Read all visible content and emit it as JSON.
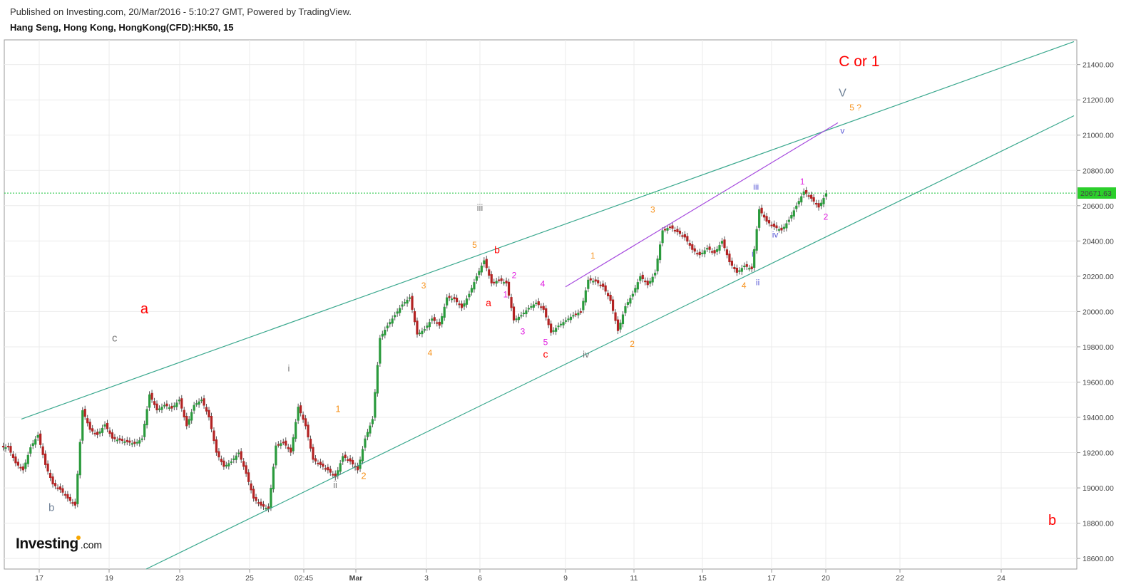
{
  "header": {
    "published": "Published on Investing.com, 20/Mar/2016 - 5:10:27 GMT, Powered by TradingView.",
    "symbol": "Hang Seng, Hong Kong, HongKong(CFD):HK50, 15"
  },
  "logo": {
    "brand": "Investing",
    "suffix": ".com"
  },
  "colors": {
    "up_candle": "#2a9a3c",
    "down_candle": "#b22222",
    "channel": "#3aa88e",
    "wedge_line": "#a64bde",
    "price_line": "#19c43a",
    "price_label_bg": "#2bcf2b",
    "grid": "#ebebeb"
  },
  "chart_data": {
    "type": "candlestick",
    "title": "",
    "xlabel": "",
    "ylabel": "",
    "ylim": [
      18540,
      21540
    ],
    "y_ticks": [
      "21400.00",
      "21200.00",
      "21000.00",
      "20800.00",
      "20600.00",
      "20400.00",
      "20200.00",
      "20000.00",
      "19800.00",
      "19600.00",
      "19400.00",
      "19200.00",
      "19000.00",
      "18800.00",
      "18600.00"
    ],
    "x_ticks": [
      "17",
      "19",
      "23",
      "25",
      "02:45",
      "Mar",
      "3",
      "6",
      "9",
      "11",
      "15",
      "17",
      "20",
      "22",
      "24"
    ],
    "current_price": "20671.63",
    "price_path": [
      [
        0,
        19230
      ],
      [
        1,
        19140
      ],
      [
        2,
        19100
      ],
      [
        3,
        19230
      ],
      [
        4,
        19300
      ],
      [
        5,
        19130
      ],
      [
        6,
        19020
      ],
      [
        7,
        18990
      ],
      [
        8,
        18940
      ],
      [
        9,
        18900
      ],
      [
        10,
        19440
      ],
      [
        11,
        19330
      ],
      [
        12,
        19300
      ],
      [
        13,
        19360
      ],
      [
        14,
        19280
      ],
      [
        15,
        19270
      ],
      [
        16,
        19260
      ],
      [
        17,
        19250
      ],
      [
        18,
        19280
      ],
      [
        19,
        19530
      ],
      [
        20,
        19440
      ],
      [
        21,
        19470
      ],
      [
        22,
        19450
      ],
      [
        23,
        19500
      ],
      [
        24,
        19350
      ],
      [
        25,
        19470
      ],
      [
        26,
        19500
      ],
      [
        27,
        19400
      ],
      [
        28,
        19200
      ],
      [
        29,
        19120
      ],
      [
        30,
        19150
      ],
      [
        31,
        19200
      ],
      [
        32,
        19080
      ],
      [
        33,
        18940
      ],
      [
        34,
        18900
      ],
      [
        35,
        18880
      ],
      [
        36,
        19240
      ],
      [
        37,
        19260
      ],
      [
        38,
        19200
      ],
      [
        39,
        19460
      ],
      [
        40,
        19350
      ],
      [
        41,
        19160
      ],
      [
        42,
        19130
      ],
      [
        43,
        19100
      ],
      [
        44,
        19060
      ],
      [
        45,
        19180
      ],
      [
        46,
        19150
      ],
      [
        47,
        19100
      ],
      [
        48,
        19280
      ],
      [
        49,
        19390
      ],
      [
        50,
        19850
      ],
      [
        51,
        19920
      ],
      [
        52,
        19980
      ],
      [
        53,
        20040
      ],
      [
        54,
        20080
      ],
      [
        55,
        19870
      ],
      [
        56,
        19900
      ],
      [
        57,
        19960
      ],
      [
        58,
        19920
      ],
      [
        59,
        20080
      ],
      [
        60,
        20070
      ],
      [
        61,
        20020
      ],
      [
        62,
        20100
      ],
      [
        63,
        20200
      ],
      [
        64,
        20290
      ],
      [
        65,
        20160
      ],
      [
        66,
        20180
      ],
      [
        67,
        20160
      ],
      [
        68,
        19950
      ],
      [
        69,
        19980
      ],
      [
        70,
        20020
      ],
      [
        71,
        20050
      ],
      [
        72,
        20010
      ],
      [
        73,
        19880
      ],
      [
        74,
        19920
      ],
      [
        75,
        19950
      ],
      [
        76,
        19980
      ],
      [
        77,
        20000
      ],
      [
        78,
        20180
      ],
      [
        79,
        20170
      ],
      [
        80,
        20140
      ],
      [
        81,
        20060
      ],
      [
        82,
        19890
      ],
      [
        83,
        20030
      ],
      [
        84,
        20100
      ],
      [
        85,
        20200
      ],
      [
        86,
        20150
      ],
      [
        87,
        20220
      ],
      [
        88,
        20460
      ],
      [
        89,
        20480
      ],
      [
        90,
        20450
      ],
      [
        91,
        20420
      ],
      [
        92,
        20350
      ],
      [
        93,
        20320
      ],
      [
        94,
        20360
      ],
      [
        95,
        20330
      ],
      [
        96,
        20400
      ],
      [
        97,
        20280
      ],
      [
        98,
        20220
      ],
      [
        99,
        20260
      ],
      [
        100,
        20240
      ],
      [
        101,
        20580
      ],
      [
        102,
        20510
      ],
      [
        103,
        20480
      ],
      [
        104,
        20460
      ],
      [
        105,
        20520
      ],
      [
        106,
        20600
      ],
      [
        107,
        20680
      ],
      [
        108,
        20640
      ],
      [
        109,
        20590
      ],
      [
        110,
        20670
      ]
    ],
    "channel_lines": [
      {
        "name": "upper",
        "from": [
          "17",
          19390
        ],
        "to": [
          "26",
          21530
        ]
      },
      {
        "name": "lower",
        "from": [
          "20",
          18540
        ],
        "to": [
          "26",
          21110
        ]
      },
      {
        "name": "wedge",
        "from": [
          "9",
          20140
        ],
        "to": [
          "20.6",
          21070
        ]
      }
    ],
    "wave_labels": [
      {
        "text": "b",
        "color": "#6e8096",
        "size": 15,
        "x": "17.35",
        "y": 18870
      },
      {
        "text": "c",
        "color": "#777777",
        "size": 15,
        "x": "19.15",
        "y": 19830
      },
      {
        "text": "a",
        "color": "#ff0000",
        "size": 20,
        "x": "19.95",
        "y": 19990
      },
      {
        "text": "i",
        "color": "#777777",
        "size": 13,
        "x": "02:20",
        "y": 19660
      },
      {
        "text": "b",
        "color": "#ff0000",
        "size": 20,
        "x": "25.35",
        "y": 18790
      },
      {
        "text": "ii",
        "color": "#777777",
        "size": 13,
        "x": "02:50",
        "y": 19000
      },
      {
        "text": "1",
        "color": "#f7931e",
        "size": 13,
        "x": "02:55",
        "y": 19430
      },
      {
        "text": "2",
        "color": "#f7931e",
        "size": 13,
        "x": "Mar-1",
        "y": 19050
      },
      {
        "text": "3",
        "color": "#f7931e",
        "size": 12,
        "x": "2.9",
        "y": 20130
      },
      {
        "text": "4",
        "color": "#f7931e",
        "size": 12,
        "x": "3.2",
        "y": 19750
      },
      {
        "text": "5",
        "color": "#f7931e",
        "size": 12,
        "x": "5.7",
        "y": 20360
      },
      {
        "text": "iii",
        "color": "#777777",
        "size": 13,
        "x": "6.0",
        "y": 20570
      },
      {
        "text": "b",
        "color": "#ff0000",
        "size": 14,
        "x": "6.6",
        "y": 20330
      },
      {
        "text": "a",
        "color": "#ff0000",
        "size": 14,
        "x": "6.3",
        "y": 20030
      },
      {
        "text": "1",
        "color": "#e020e0",
        "size": 12,
        "x": "6.9",
        "y": 20080
      },
      {
        "text": "2",
        "color": "#e020e0",
        "size": 12,
        "x": "7.2",
        "y": 20190
      },
      {
        "text": "3",
        "color": "#e020e0",
        "size": 12,
        "x": "7.5",
        "y": 19870
      },
      {
        "text": "4",
        "color": "#e020e0",
        "size": 12,
        "x": "8.2",
        "y": 20140
      },
      {
        "text": "5",
        "color": "#e020e0",
        "size": 12,
        "x": "8.3",
        "y": 19810
      },
      {
        "text": "c",
        "color": "#ff0000",
        "size": 14,
        "x": "8.3",
        "y": 19740
      },
      {
        "text": "iv",
        "color": "#777777",
        "size": 13,
        "x": "9.6",
        "y": 19740
      },
      {
        "text": "1",
        "color": "#f7931e",
        "size": 12,
        "x": "9.8",
        "y": 20300
      },
      {
        "text": "2",
        "color": "#f7931e",
        "size": 12,
        "x": "10.95",
        "y": 19800
      },
      {
        "text": "3",
        "color": "#f7931e",
        "size": 12,
        "x": "12.1",
        "y": 20560
      },
      {
        "text": "4",
        "color": "#f7931e",
        "size": 12,
        "x": "16.2",
        "y": 20130
      },
      {
        "text": "i",
        "color": "#5b5bd6",
        "size": 12,
        "x": "16.45",
        "y": 20310
      },
      {
        "text": "ii",
        "color": "#5b5bd6",
        "size": 12,
        "x": "16.6",
        "y": 20150
      },
      {
        "text": "iii",
        "color": "#5b5bd6",
        "size": 12,
        "x": "16.55",
        "y": 20690
      },
      {
        "text": "iv",
        "color": "#5b5bd6",
        "size": 12,
        "x": "17.2",
        "y": 20420
      },
      {
        "text": "1",
        "color": "#e020e0",
        "size": 12,
        "x": "18.7",
        "y": 20720
      },
      {
        "text": "2",
        "color": "#e020e0",
        "size": 12,
        "x": "20.0",
        "y": 20520
      },
      {
        "text": "v",
        "color": "#5b5bd6",
        "size": 12,
        "x": "20.45",
        "y": 21010
      },
      {
        "text": "5 ?",
        "color": "#f7931e",
        "size": 12,
        "x": "20.8",
        "y": 21140
      },
      {
        "text": "V",
        "color": "#6e8096",
        "size": 16,
        "x": "20.45",
        "y": 21220
      },
      {
        "text": "C or 1",
        "color": "#ff0000",
        "size": 21,
        "x": "20.9",
        "y": 21390
      }
    ]
  }
}
